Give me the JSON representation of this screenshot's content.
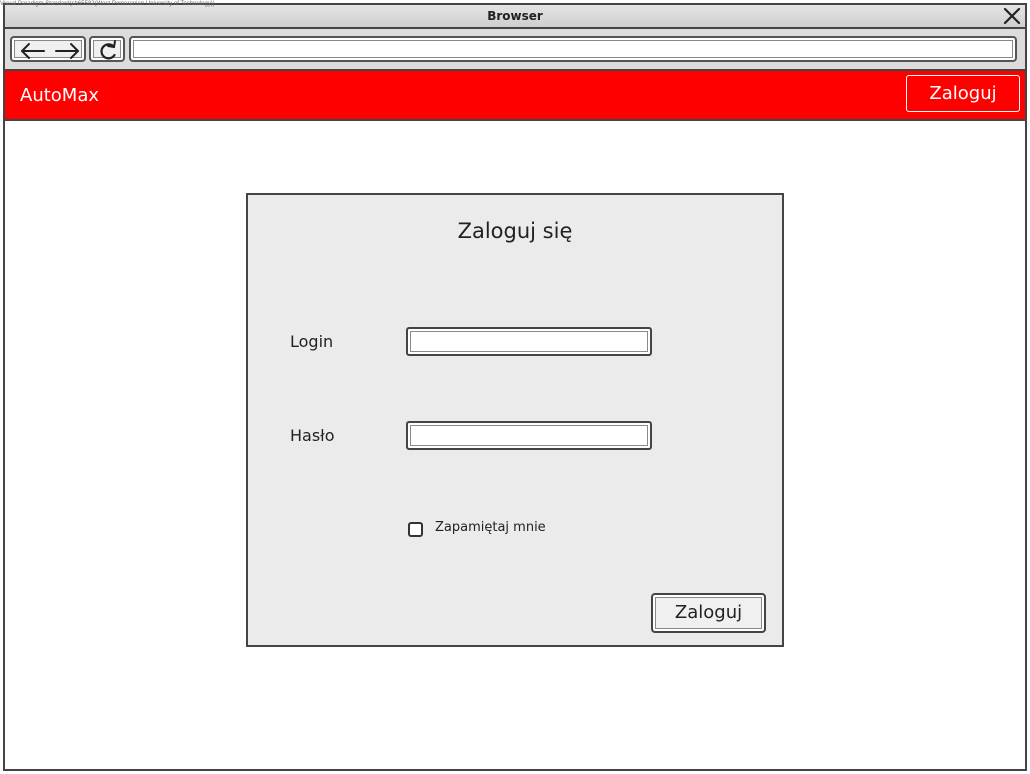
{
  "watermark": "Visual Paradigm Standard(sh65582(West Pomeranian University of Technology))",
  "window": {
    "title": "Browser",
    "close_icon": "close-x-icon"
  },
  "browser": {
    "back_icon": "arrow-left-icon",
    "forward_icon": "arrow-right-icon",
    "reload_icon": "reload-icon",
    "address": ""
  },
  "header": {
    "brand": "AutoMax",
    "login_button": "Zaloguj",
    "background_color": "#ff0000"
  },
  "login_form": {
    "title": "Zaloguj się",
    "login_label": "Login",
    "login_value": "",
    "password_label": "Hasło",
    "password_value": "",
    "remember_label": "Zapamiętaj mnie",
    "remember_checked": false,
    "submit_button": "Zaloguj"
  }
}
